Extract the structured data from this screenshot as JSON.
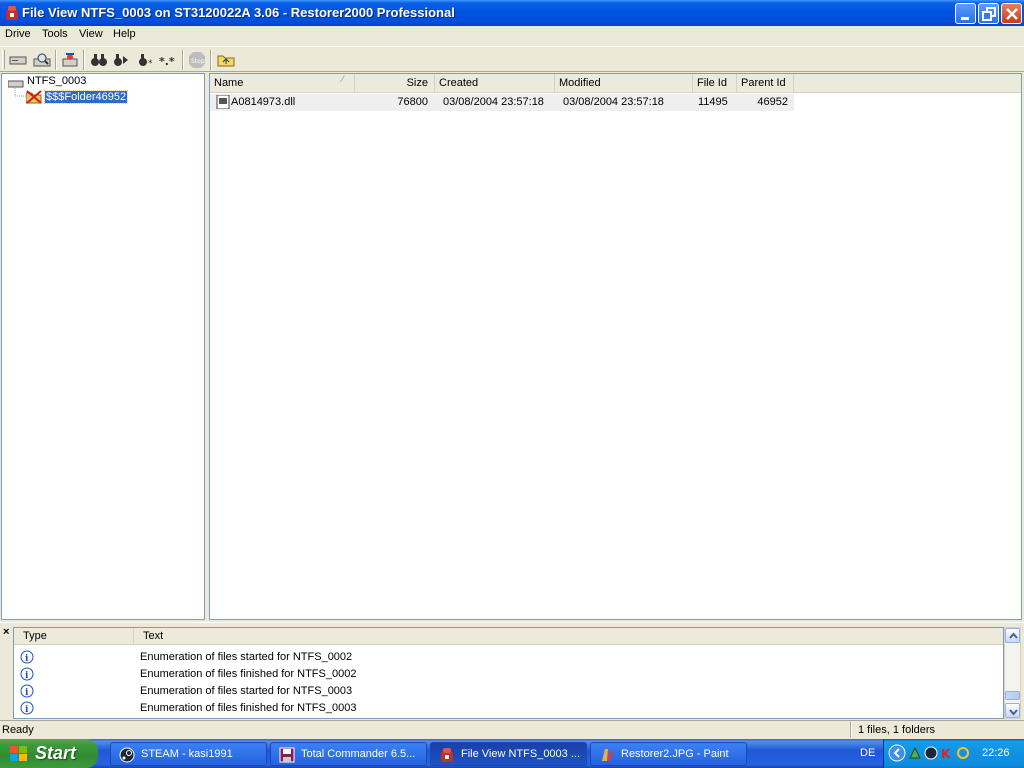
{
  "window": {
    "title": "File View NTFS_0003 on ST3120022A 3.06 - Restorer2000 Professional"
  },
  "menu": [
    "Drive",
    "Tools",
    "View",
    "Help"
  ],
  "toolbar": {
    "buttons": [
      "drive-icon",
      "search-drive-icon",
      "scan-icon",
      "find-icon",
      "find-next-icon",
      "find-mask-icon",
      "mask-icon",
      "stop-icon",
      "up-folder-icon"
    ]
  },
  "tree": {
    "root": "NTFS_0003",
    "child": "$$$Folder46952"
  },
  "list": {
    "columns": [
      "Name",
      "Size",
      "Created",
      "Modified",
      "File Id",
      "Parent Id"
    ],
    "rows": [
      {
        "name": "A0814973.dll",
        "size": "76800",
        "created": "03/08/2004 23:57:18",
        "modified": "03/08/2004 23:57:18",
        "file_id": "11495",
        "parent_id": "46952"
      }
    ]
  },
  "log": {
    "close": "×",
    "columns": [
      "Type",
      "Text"
    ],
    "rows": [
      "Enumeration of files started for NTFS_0002",
      "Enumeration of files finished for NTFS_0002",
      "Enumeration of files started for NTFS_0003",
      "Enumeration of files finished for NTFS_0003"
    ]
  },
  "status": {
    "left": "Ready",
    "right": "1 files, 1 folders"
  },
  "taskbar": {
    "start": "Start",
    "tasks": [
      {
        "label": "STEAM - kasi1991",
        "icon": "steam-icon"
      },
      {
        "label": "Total Commander 6.5...",
        "icon": "floppy-icon"
      },
      {
        "label": "File View NTFS_0003 ...",
        "icon": "restorer-icon",
        "active": true
      },
      {
        "label": "Restorer2.JPG - Paint",
        "icon": "paint-icon"
      }
    ],
    "lang": "DE",
    "clock": "22:26"
  }
}
